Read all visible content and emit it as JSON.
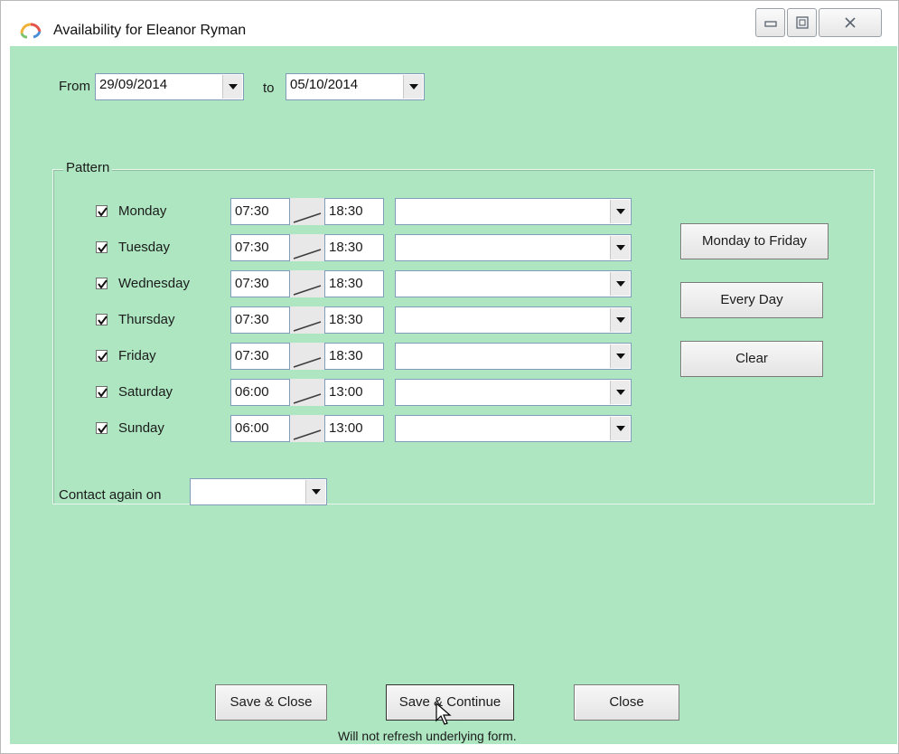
{
  "window": {
    "title": "Availability for Eleanor Ryman",
    "controls": [
      "minimize-icon",
      "maximize-icon",
      "close-icon"
    ]
  },
  "date_range": {
    "from_label": "From",
    "from_value": "29/09/2014",
    "to_label": "to",
    "to_value": "05/10/2014"
  },
  "pattern": {
    "label": "Pattern",
    "days": [
      {
        "name": "Monday",
        "checked": true,
        "start": "07:30",
        "end": "18:30",
        "option": ""
      },
      {
        "name": "Tuesday",
        "checked": true,
        "start": "07:30",
        "end": "18:30",
        "option": ""
      },
      {
        "name": "Wednesday",
        "checked": true,
        "start": "07:30",
        "end": "18:30",
        "option": ""
      },
      {
        "name": "Thursday",
        "checked": true,
        "start": "07:30",
        "end": "18:30",
        "option": ""
      },
      {
        "name": "Friday",
        "checked": true,
        "start": "07:30",
        "end": "18:30",
        "option": ""
      },
      {
        "name": "Saturday",
        "checked": true,
        "start": "06:00",
        "end": "13:00",
        "option": ""
      },
      {
        "name": "Sunday",
        "checked": true,
        "start": "06:00",
        "end": "13:00",
        "option": ""
      }
    ],
    "buttons": {
      "weekdays": "Monday to Friday",
      "every_day": "Every Day",
      "clear": "Clear"
    }
  },
  "contact": {
    "label": "Contact again on",
    "value": ""
  },
  "footer": {
    "save_close": "Save & Close",
    "save_continue": "Save & Continue",
    "close": "Close",
    "note": "Will not refresh underlying form."
  },
  "colors": {
    "background": "#aee6c1",
    "button_face": "#ececec"
  }
}
